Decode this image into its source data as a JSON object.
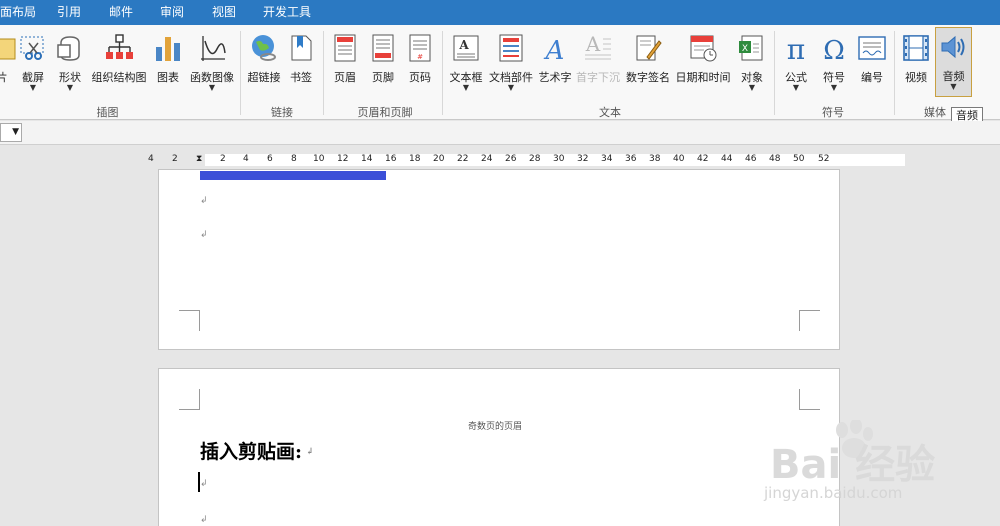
{
  "menu": [
    "面布局",
    "引用",
    "邮件",
    "审阅",
    "视图",
    "开发工具"
  ],
  "ribbon": {
    "groups": {
      "illustrations": "插图",
      "links": "链接",
      "header_footer": "页眉和页脚",
      "text": "文本",
      "symbols": "符号",
      "media": "媒体"
    },
    "buttons": {
      "picture_partial": "片",
      "screenshot": "截屏",
      "shapes": "形状",
      "smartart": "组织结构图",
      "chart": "图表",
      "function_image": "函数图像",
      "hyperlink": "超链接",
      "bookmark": "书签",
      "header": "页眉",
      "footer": "页脚",
      "page_number": "页码",
      "textbox": "文本框",
      "quick_parts": "文档部件",
      "wordart": "艺术字",
      "drop_cap": "首字下沉",
      "signature": "数字签名",
      "datetime": "日期和时间",
      "object": "对象",
      "equation": "公式",
      "symbol": "符号",
      "numbering": "编号",
      "video": "视频",
      "audio": "音频"
    },
    "tooltip": "音频"
  },
  "ruler": {
    "ticks": [
      "4",
      "2",
      "2",
      "4",
      "6",
      "8",
      "10",
      "12",
      "14",
      "16",
      "18",
      "20",
      "22",
      "24",
      "26",
      "28",
      "30",
      "32",
      "34",
      "36",
      "38",
      "40",
      "42",
      "44",
      "46",
      "48",
      "50",
      "52"
    ]
  },
  "document": {
    "page2_header": "奇数页的页眉",
    "heading": "插入剪贴画:",
    "para_mark": "↲"
  },
  "watermark": {
    "brand": "Bai 经验",
    "url": "jingyan.baidu.com"
  }
}
